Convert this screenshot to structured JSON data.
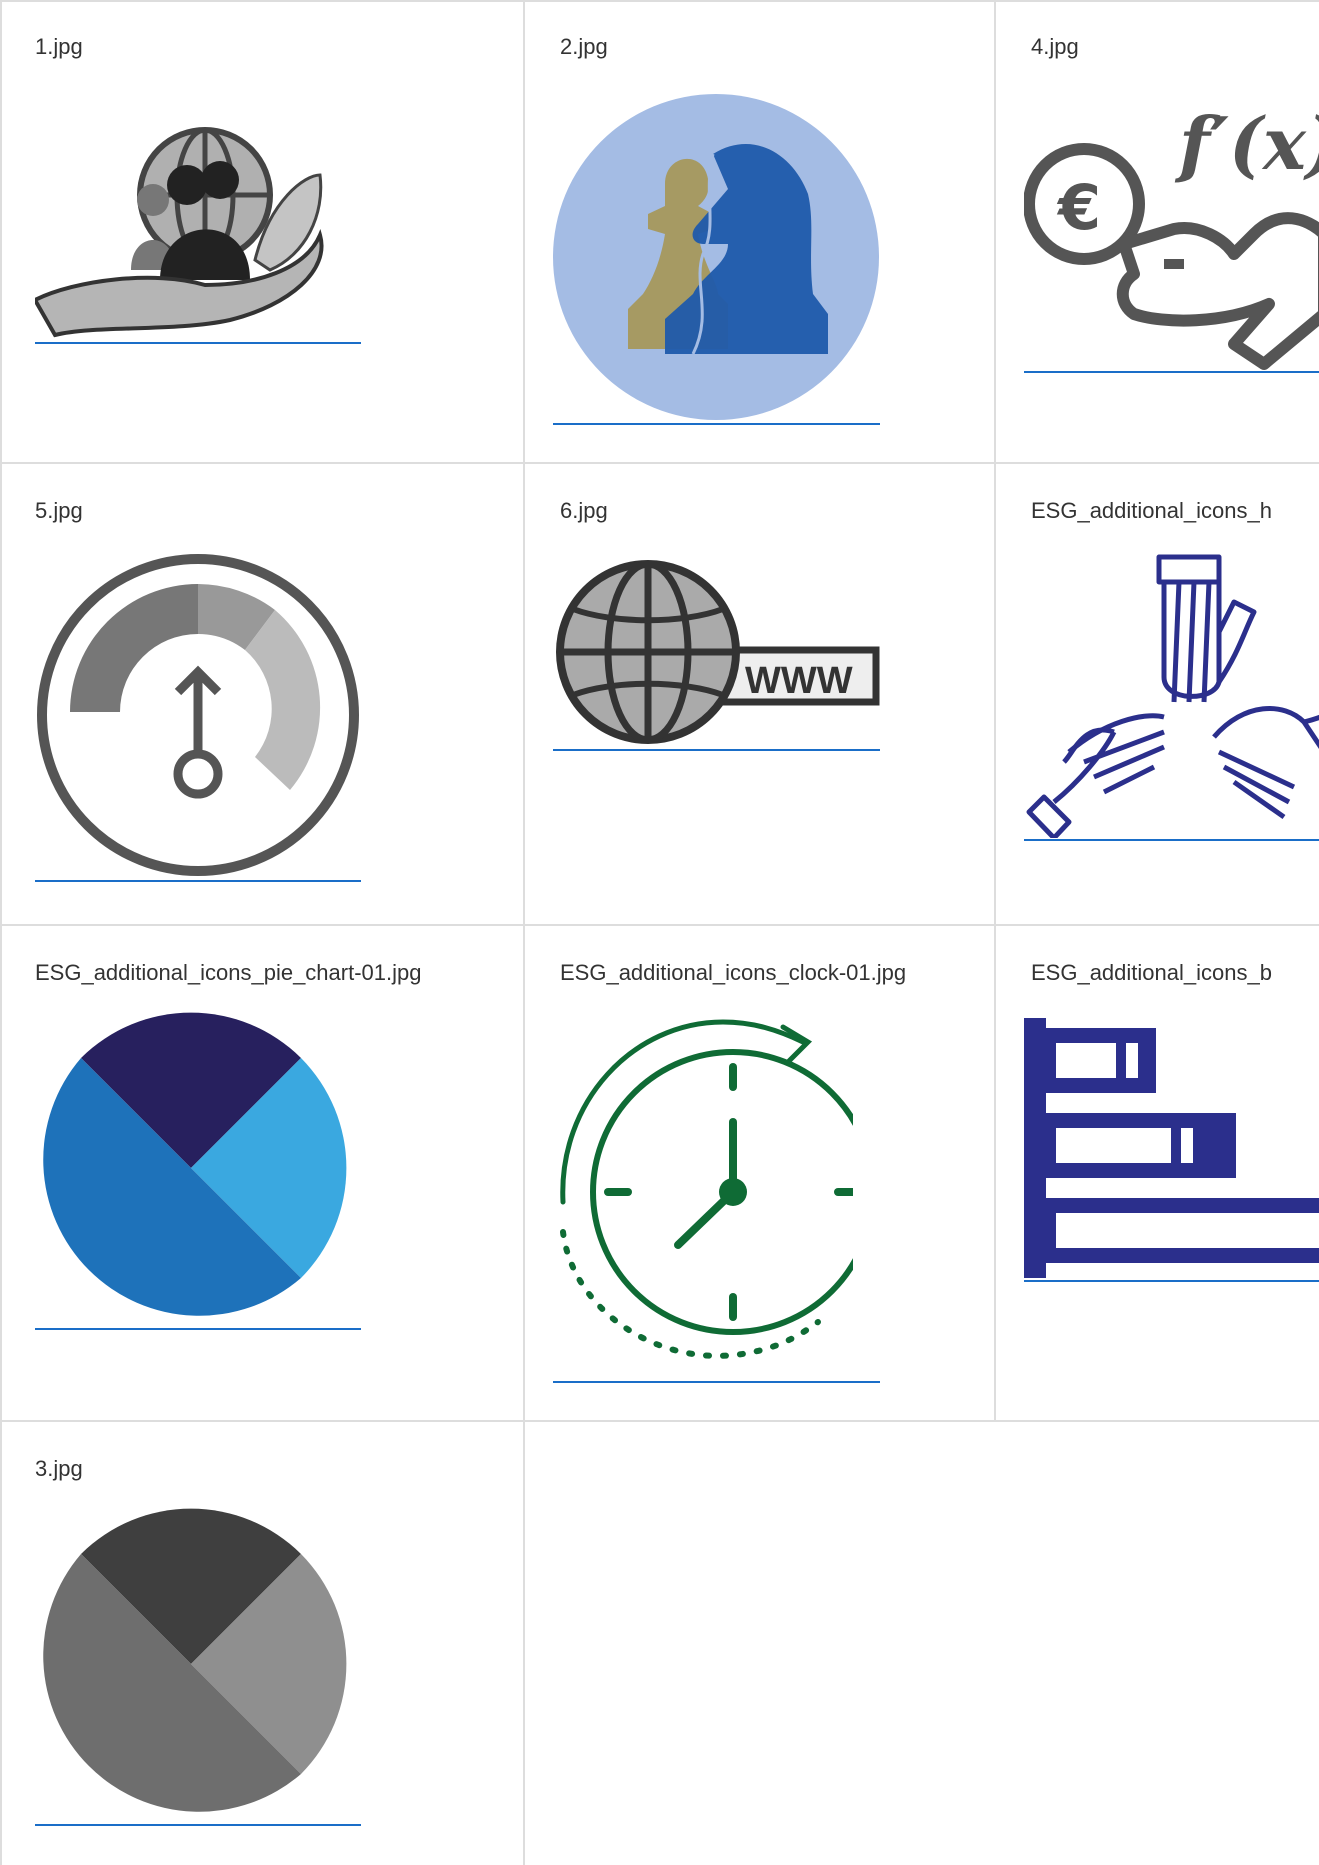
{
  "gallery": {
    "items": [
      {
        "filename": "1.jpg",
        "icon": "hand-globe-people-leaf-icon"
      },
      {
        "filename": "2.jpg",
        "icon": "chess-pawn-knight-icon"
      },
      {
        "filename": "4.jpg",
        "icon": "euro-coin-function-hand-icon"
      },
      {
        "filename": "5.jpg",
        "icon": "gauge-meter-icon"
      },
      {
        "filename": "6.jpg",
        "icon": "globe-www-icon"
      },
      {
        "filename": "ESG_additional_icons_h",
        "icon": "three-hands-icon"
      },
      {
        "filename": "ESG_additional_icons_pie_chart-01.jpg",
        "icon": "pie-chart-icon"
      },
      {
        "filename": "ESG_additional_icons_clock-01.jpg",
        "icon": "clock-cycle-icon"
      },
      {
        "filename": "ESG_additional_icons_b",
        "icon": "bar-chart-icon"
      },
      {
        "filename": "3.jpg",
        "icon": "pie-chart-grey-icon"
      }
    ]
  },
  "colors": {
    "link_underline": "#1a6ec8",
    "grid_line": "#dddddd",
    "text": "#333333",
    "navy": "#2b2f8c",
    "green": "#0f6b35",
    "pie_dark": "#27205e",
    "pie_blue": "#1e72ba",
    "pie_light": "#3aa8e0"
  }
}
